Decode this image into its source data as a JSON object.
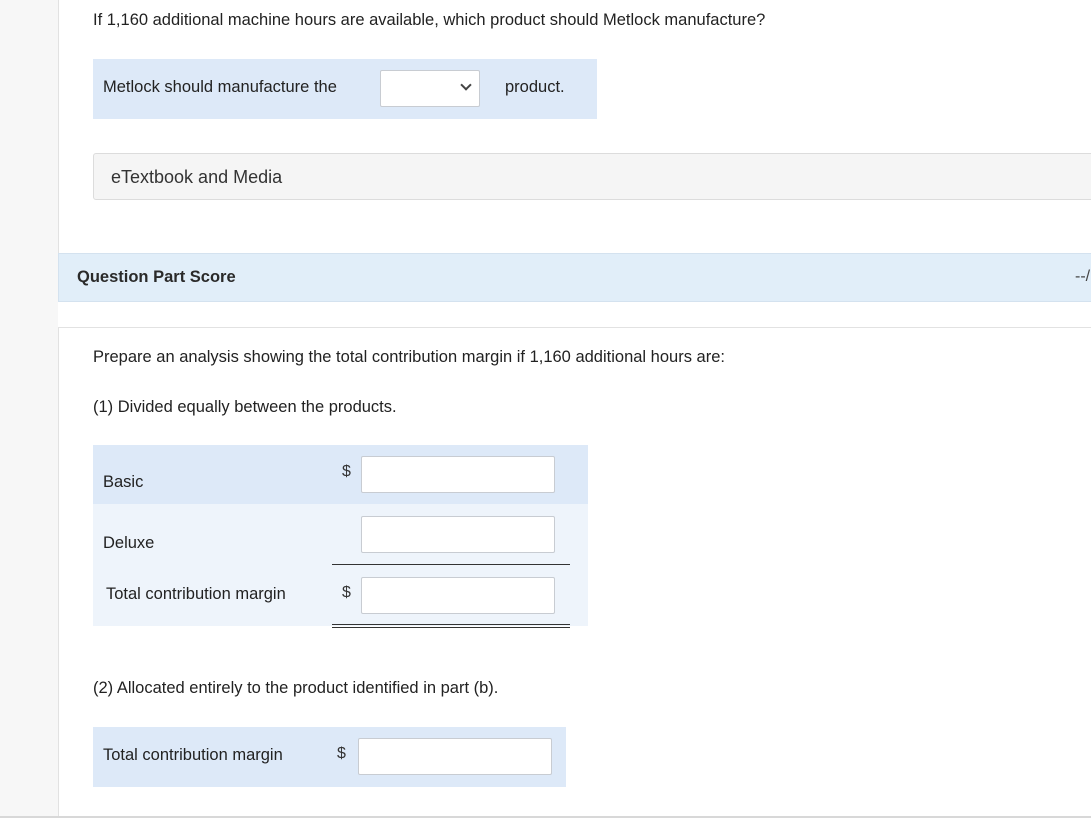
{
  "question_b": {
    "prompt": "If 1,160 additional machine hours are available, which product should Metlock manufacture?",
    "answer_prefix": "Metlock should manufacture the",
    "answer_select_value": "",
    "answer_suffix": "product."
  },
  "resources": {
    "etextbook_label": "eTextbook and Media"
  },
  "score_bar": {
    "label": "Question Part Score",
    "value": "--/"
  },
  "question_c": {
    "prompt": "Prepare an analysis showing the total contribution margin if 1,160 additional hours are:",
    "part1_label": "(1) Divided equally between the products.",
    "part1_rows": [
      {
        "label": "Basic",
        "currency": "$",
        "value": ""
      },
      {
        "label": "Deluxe",
        "currency": "",
        "value": ""
      },
      {
        "label": "Total contribution margin",
        "currency": "$",
        "value": ""
      }
    ],
    "part2_label": "(2) Allocated entirely to the product identified in part (b).",
    "part2_row": {
      "label": "Total contribution margin",
      "currency": "$",
      "value": ""
    }
  }
}
